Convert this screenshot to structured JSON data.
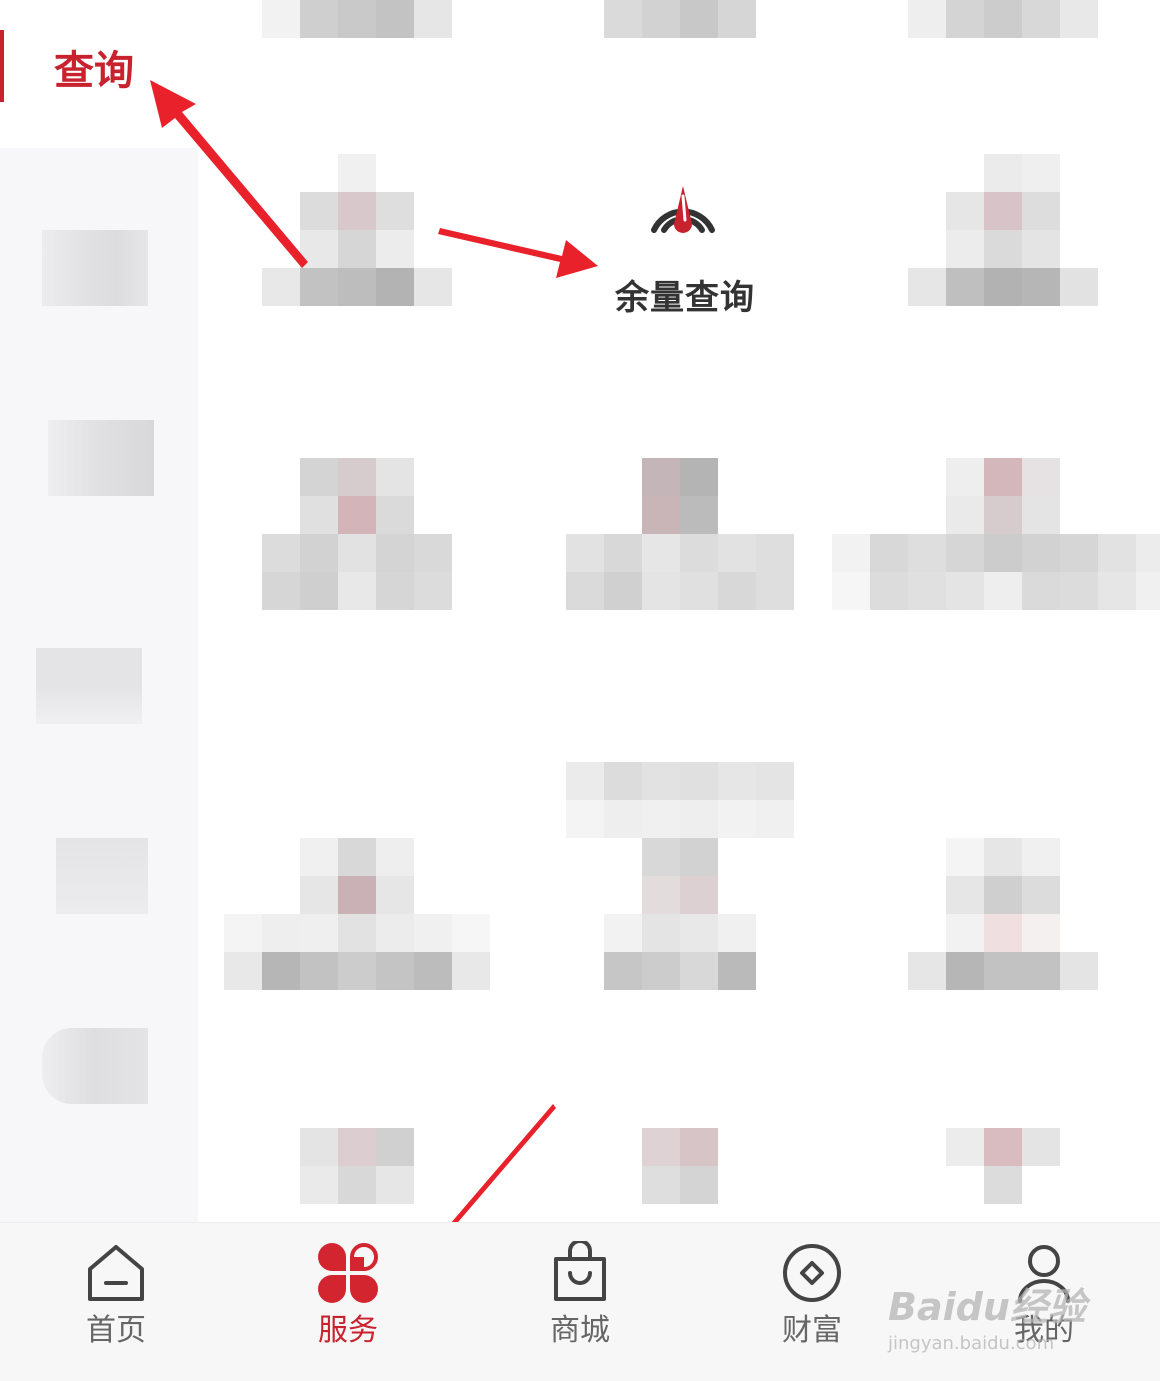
{
  "sidebar": {
    "active_label": "查询"
  },
  "featured": {
    "label": "余量查询",
    "icon": "signal-gauge-icon",
    "accent": "#c8222e"
  },
  "tabbar": {
    "items": [
      {
        "label": "首页",
        "icon": "home-icon",
        "active": false
      },
      {
        "label": "服务",
        "icon": "clover-icon",
        "active": true
      },
      {
        "label": "商城",
        "icon": "shopping-bag-icon",
        "active": false
      },
      {
        "label": "财富",
        "icon": "coin-icon",
        "active": false
      },
      {
        "label": "我的",
        "icon": "user-icon",
        "active": false
      }
    ]
  },
  "watermark": {
    "main": "Baidu经验",
    "sub": "jingyan.baidu.com"
  },
  "colors": {
    "accent": "#c8222e",
    "annotation_arrow": "#e8212b"
  }
}
